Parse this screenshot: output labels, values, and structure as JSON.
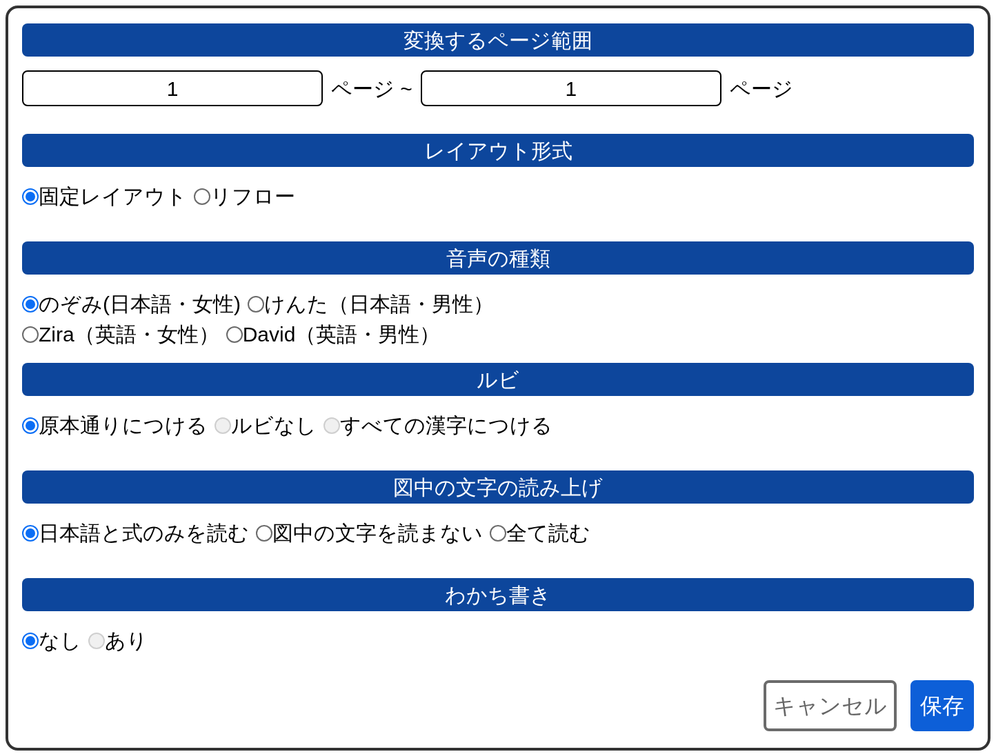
{
  "sections": [
    {
      "kind": "range",
      "title": "変換するページ範囲",
      "from": "1",
      "from_unit": "ページ ~",
      "to": "1",
      "to_unit": "ページ"
    },
    {
      "kind": "radios",
      "title": "レイアウト形式",
      "rows": [
        [
          {
            "label": "固定レイアウト",
            "selected": true,
            "disabled": false
          },
          {
            "label": "リフロー",
            "selected": false,
            "disabled": false
          }
        ]
      ]
    },
    {
      "kind": "radios",
      "title": "音声の種類",
      "rows": [
        [
          {
            "label": "のぞみ(日本語・女性)",
            "selected": true,
            "disabled": false
          },
          {
            "label": "けんた（日本語・男性）",
            "selected": false,
            "disabled": false
          }
        ],
        [
          {
            "label": "Zira（英語・女性）",
            "selected": false,
            "disabled": false
          },
          {
            "label": "David（英語・男性）",
            "selected": false,
            "disabled": false
          }
        ]
      ]
    },
    {
      "kind": "radios",
      "title": "ルビ",
      "rows": [
        [
          {
            "label": "原本通りにつける",
            "selected": true,
            "disabled": false
          },
          {
            "label": "ルビなし",
            "selected": false,
            "disabled": true
          },
          {
            "label": "すべての漢字につける",
            "selected": false,
            "disabled": true
          }
        ]
      ]
    },
    {
      "kind": "radios",
      "title": "図中の文字の読み上げ",
      "rows": [
        [
          {
            "label": "日本語と式のみを読む",
            "selected": true,
            "disabled": false
          },
          {
            "label": "図中の文字を読まない",
            "selected": false,
            "disabled": false
          },
          {
            "label": "全て読む",
            "selected": false,
            "disabled": false
          }
        ]
      ]
    },
    {
      "kind": "radios",
      "title": "わかち書き",
      "rows": [
        [
          {
            "label": "なし",
            "selected": true,
            "disabled": false
          },
          {
            "label": "あり",
            "selected": false,
            "disabled": true
          }
        ]
      ]
    }
  ],
  "buttons": [
    {
      "kind": "secondary",
      "label": "キャンセル"
    },
    {
      "kind": "primary",
      "label": "保存"
    }
  ]
}
